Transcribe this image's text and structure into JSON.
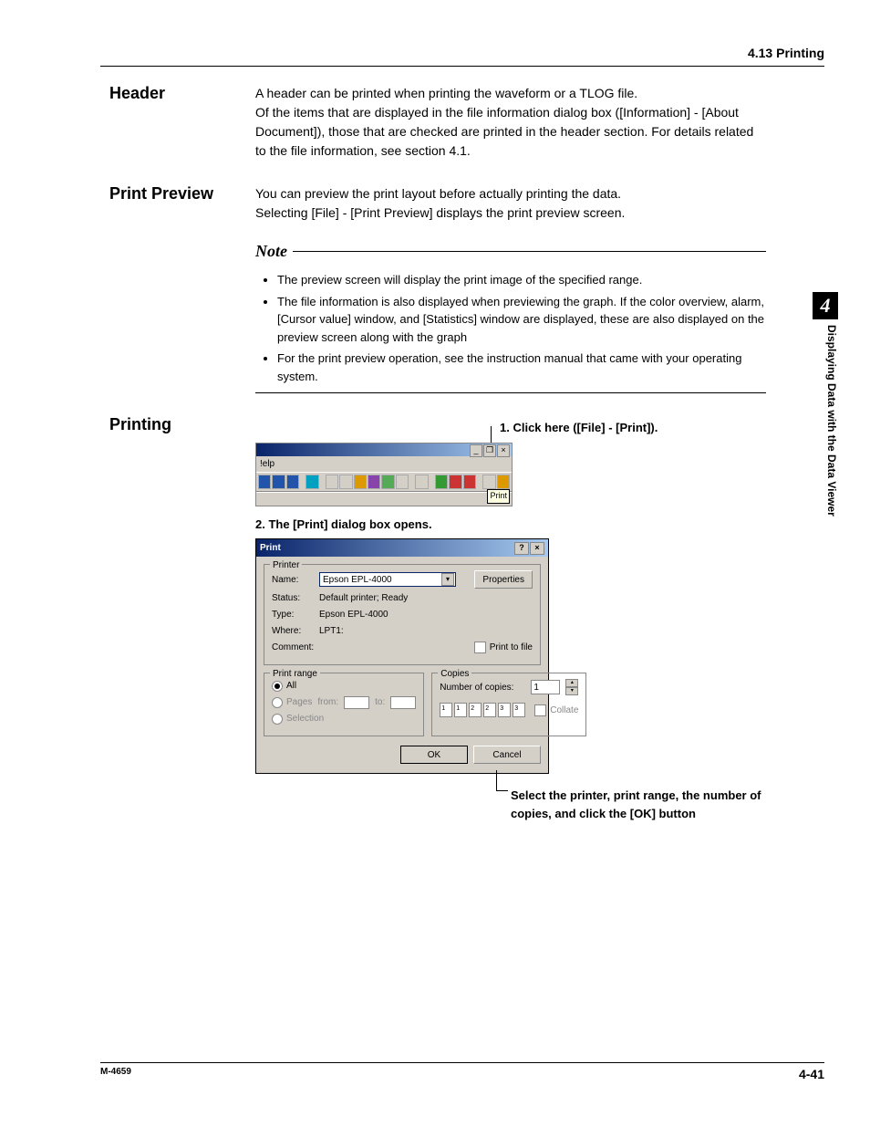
{
  "header": {
    "section_ref": "4.13  Printing"
  },
  "side_tab": {
    "number": "4",
    "text": "Displaying Data with the Data Viewer"
  },
  "sections": {
    "header_sec": {
      "title": "Header",
      "p1": "A header can be printed when printing the waveform or a TLOG file.",
      "p2": "Of the items that are displayed in the file information dialog box ([Information] - [About Document]), those that are checked are printed in the header section.  For details related to the file information, see section 4.1."
    },
    "preview_sec": {
      "title": "Print Preview",
      "p1": "You can preview the print layout before actually printing the data.",
      "p2": "Selecting [File] - [Print Preview] displays the print preview screen.",
      "note_label": "Note",
      "notes": [
        "The preview screen will display the print image of the specified range.",
        "The file information is also displayed when previewing the graph.  If the color overview, alarm, [Cursor value] window, and [Statistics] window are displayed, these are also displayed on the preview screen along with the graph",
        "For the print preview operation, see the instruction manual that came with your operating system."
      ]
    },
    "printing_sec": {
      "title": "Printing",
      "step1_caption": "1. Click here ([File] - [Print]).",
      "shot1": {
        "menu": "!elp",
        "tooltip": "Print"
      },
      "step2_caption": "2. The [Print] dialog box opens.",
      "dialog": {
        "title": "Print",
        "printer_group": "Printer",
        "name_lbl": "Name:",
        "name_val": "Epson EPL-4000",
        "properties_btn": "Properties",
        "status_lbl": "Status:",
        "status_val": "Default printer; Ready",
        "type_lbl": "Type:",
        "type_val": "Epson EPL-4000",
        "where_lbl": "Where:",
        "where_val": "LPT1:",
        "comment_lbl": "Comment:",
        "print_to_file": "Print to file",
        "range_group": "Print range",
        "range_all": "All",
        "range_pages": "Pages",
        "from_lbl": "from:",
        "to_lbl": "to:",
        "range_selection": "Selection",
        "copies_group": "Copies",
        "num_copies_lbl": "Number of copies:",
        "num_copies_val": "1",
        "collate_lbl": "Collate",
        "ok_btn": "OK",
        "cancel_btn": "Cancel"
      },
      "annotation_below": "Select the printer, print range, the number of copies, and click the [OK] button"
    }
  },
  "footer": {
    "left": "M-4659",
    "right": "4-41"
  }
}
